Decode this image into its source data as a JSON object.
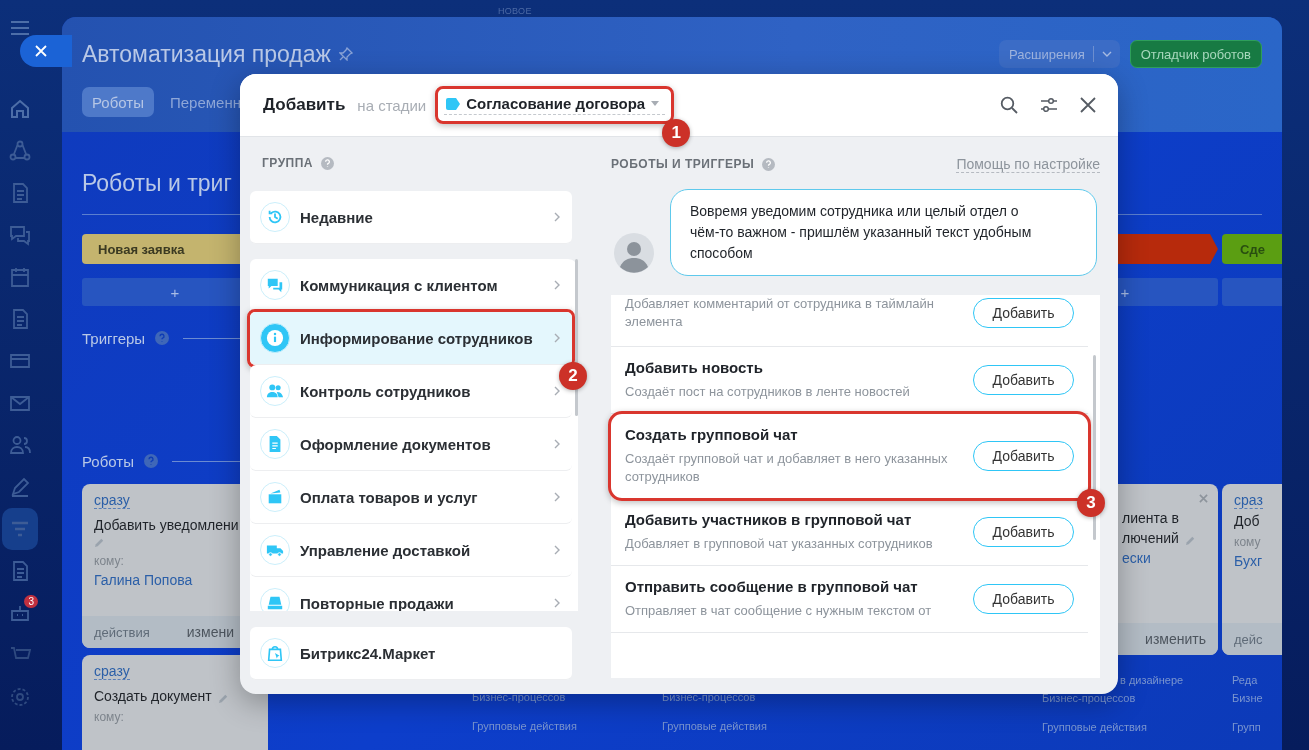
{
  "top_label": "НОВОЕ",
  "sidebar": {
    "badge": "3"
  },
  "page": {
    "title": "Автоматизация продаж",
    "extensions_button": "Расширения",
    "debugger_button": "Отладчик роботов",
    "tabs": [
      {
        "label": "Роботы",
        "selected": true
      },
      {
        "label": "Переменн",
        "selected": false
      }
    ],
    "heading": "Роботы и триг",
    "stage_left": {
      "name": "Новая заявка",
      "color": "#c4b46e"
    },
    "stages_right": [
      {
        "color": "#b72a0c"
      },
      {
        "name": "Сде",
        "color": "#5b9e12"
      }
    ],
    "add_left": "+",
    "add_right": "+",
    "triggers_label": "Триггеры",
    "robots_label": "Роботы",
    "robots_left": [
      {
        "delay": "сразу",
        "name": "Добавить уведомлени",
        "to_label": "кому:",
        "to": "Галина Попова",
        "actions": "действия",
        "edit": "измени"
      },
      {
        "delay": "сразу",
        "name": "Создать документ",
        "to_label": "кому:"
      }
    ],
    "middle_links": [
      [
        "Бизнес-процессов",
        "Групповые действия"
      ],
      [
        "Бизнес-процессов",
        "Групповые действия"
      ]
    ],
    "robots_right": [
      {
        "name_lines": [
          "лиента в",
          "лючений"
        ],
        "to": "ески",
        "edit": "изменить",
        "links": [
          "в дизайнере",
          "Бизнес-процессов",
          "Групповые действия"
        ]
      },
      {
        "delay": "сраз",
        "name_lines": [
          "Доб"
        ],
        "to_label": "кому",
        "to": "Бухг",
        "actions": "дейс",
        "links": [
          "Реда",
          "Бизне",
          "Групп"
        ]
      }
    ]
  },
  "dialog": {
    "title": "Добавить",
    "stage_label": "на стадии",
    "stage": {
      "name": "Согласование договора",
      "color": "#2fc6f6"
    },
    "stage_callout": "1",
    "group_label": "ГРУППА",
    "recent": {
      "label": "Недавние",
      "kind": "recent"
    },
    "groups": [
      {
        "label": "Коммуникация с клиентом",
        "kind": "chat",
        "selected": false
      },
      {
        "label": "Информирование сотрудников",
        "kind": "info",
        "selected": true,
        "callout": "2"
      },
      {
        "label": "Контроль сотрудников",
        "kind": "people",
        "selected": false
      },
      {
        "label": "Оформление документов",
        "kind": "document",
        "selected": false
      },
      {
        "label": "Оплата товаров и услуг",
        "kind": "payment",
        "selected": false
      },
      {
        "label": "Управление доставкой",
        "kind": "delivery",
        "selected": false
      },
      {
        "label": "Повторные продажи",
        "kind": "sales",
        "selected": false
      }
    ],
    "market": {
      "label": "Битрикс24.Маркет",
      "kind": "market"
    },
    "robots_label": "РОБОТЫ И ТРИГГЕРЫ",
    "help_link": "Помощь по настройке",
    "hint": "Вовремя уведомим сотрудника или целый отдел о чём-то важном - пришлём указанный текст удобным способом",
    "robots": [
      {
        "description": "Добавляет комментарий от сотрудника в таймлайн элемента",
        "button": "Добавить"
      },
      {
        "title": "Добавить новость",
        "description": "Создаёт пост на сотрудников в ленте новостей",
        "button": "Добавить"
      },
      {
        "title": "Создать групповой чат",
        "description": "Создаёт групповой чат и добавляет в него указанных сотрудников",
        "button": "Добавить",
        "callout": "3"
      },
      {
        "title": "Добавить участников в групповой чат",
        "description": "Добавляет в групповой чат указанных сотрудников",
        "button": "Добавить"
      },
      {
        "title": "Отправить сообщение в групповой чат",
        "description": "Отправляет в чат сообщение с нужным текстом от",
        "button": "Добавить"
      }
    ]
  }
}
